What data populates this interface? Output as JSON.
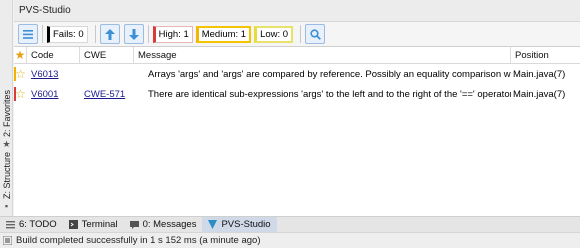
{
  "window": {
    "title": "PVS-Studio"
  },
  "toolbar": {
    "fails_label": "Fails: 0",
    "high_label": "High: 1",
    "medium_label": "Medium: 1",
    "low_label": "Low: 0",
    "menu_icon": "hamburger-menu-icon",
    "up_icon": "arrow-up-icon",
    "down_icon": "arrow-down-icon",
    "search_icon": "magnifier-icon"
  },
  "table": {
    "columns": {
      "code": "Code",
      "cwe": "CWE",
      "message": "Message",
      "position": "Position"
    },
    "rows": [
      {
        "code": "V6013",
        "cwe": "",
        "message": "Arrays 'args' and 'args' are compared by reference. Possibly an equality comparison was intended.",
        "position": "Main.java(7)",
        "severity_color": "#f0b400"
      },
      {
        "code": "V6001",
        "cwe": "CWE-571",
        "message": "There are identical sub-expressions 'args' to the left and to the right of the '==' operator.",
        "position": "Main.java(7)",
        "severity_color": "#d93a3a"
      }
    ]
  },
  "left_tabs": {
    "favorites": "2: Favorites",
    "structure": "Z: Structure"
  },
  "bottom_tabs": {
    "todo": "6: TODO",
    "terminal": "Terminal",
    "messages": "0: Messages",
    "pvs": "PVS-Studio"
  },
  "status": {
    "text": "Build completed successfully in 1 s 152 ms (a minute ago)"
  },
  "colors": {
    "accent_blue": "#3d8fd6",
    "high": "#d93a3a",
    "medium": "#f5c400",
    "low": "#e8e26a",
    "star": "#e8a11b"
  }
}
